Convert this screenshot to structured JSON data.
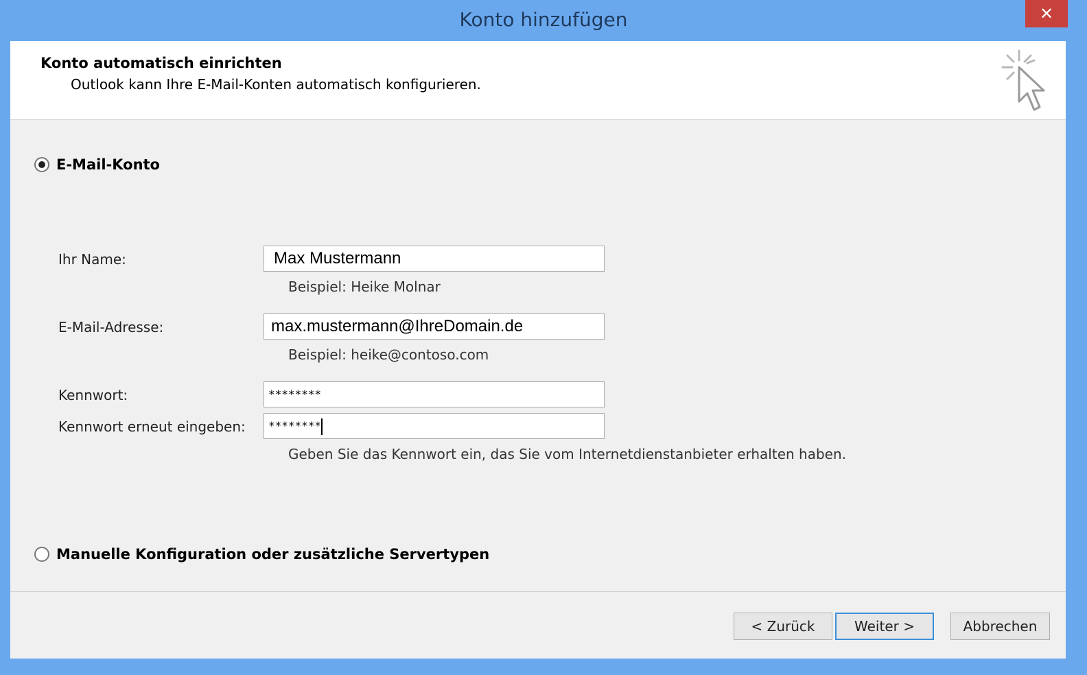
{
  "window": {
    "title": "Konto hinzufügen",
    "close_glyph": "✕"
  },
  "header": {
    "title": "Konto automatisch einrichten",
    "subtitle": "Outlook kann Ihre E-Mail-Konten automatisch konfigurieren.",
    "icon": "wizard-cursor-icon"
  },
  "options": {
    "email_account": {
      "label": "E-Mail-Konto",
      "selected": true
    },
    "manual_config": {
      "label": "Manuelle Konfiguration oder zusätzliche Servertypen",
      "selected": false
    }
  },
  "form": {
    "name": {
      "label": "Ihr Name:",
      "value": "Max Mustermann",
      "hint": "Beispiel: Heike Molnar"
    },
    "email": {
      "label": "E-Mail-Adresse:",
      "value": "max.mustermann@IhreDomain.de",
      "hint": "Beispiel: heike@contoso.com"
    },
    "password": {
      "label": "Kennwort:",
      "value": "********"
    },
    "password_repeat": {
      "label": "Kennwort erneut eingeben:",
      "value": "********"
    },
    "password_hint": "Geben Sie das Kennwort ein, das Sie vom Internetdienstanbieter erhalten haben."
  },
  "buttons": {
    "back": "< Zurück",
    "next": "Weiter >",
    "cancel": "Abbrechen"
  },
  "colors": {
    "title_bar": "#6aa8ee",
    "close": "#c7413d",
    "client": "#f0f0f0",
    "default_button_border": "#3c8fd8"
  }
}
